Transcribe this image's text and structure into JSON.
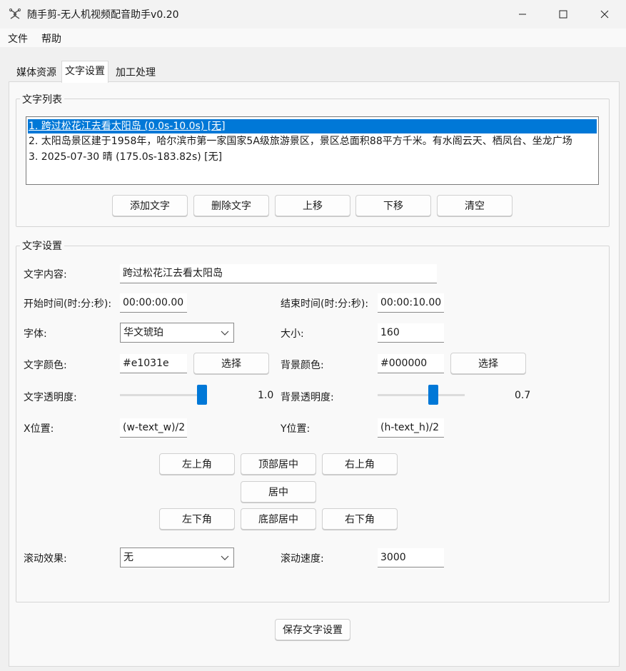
{
  "window": {
    "title": "随手剪-无人机视频配音助手v0.20",
    "minimize_icon": "minimize-icon",
    "maximize_icon": "maximize-icon",
    "close_icon": "close-icon"
  },
  "menu": {
    "items": [
      "文件",
      "帮助"
    ]
  },
  "tabs": [
    {
      "label": "媒体资源",
      "active": false
    },
    {
      "label": "文字设置",
      "active": true
    },
    {
      "label": "加工处理",
      "active": false
    }
  ],
  "text_list": {
    "group_title": "文字列表",
    "items": [
      "1. 跨过松花江去看太阳岛 (0.0s-10.0s) [无]",
      "2. 太阳岛景区建于1958年，哈尔滨市第一家国家5A级旅游景区，景区总面积88平方千米。有水阁云天、栖凤台、坐龙广场",
      "3. 2025-07-30 晴 (175.0s-183.82s) [无]"
    ],
    "selected_index": 0,
    "buttons": {
      "add": "添加文字",
      "delete": "删除文字",
      "move_up": "上移",
      "move_down": "下移",
      "clear": "清空"
    }
  },
  "text_settings": {
    "group_title": "文字设置",
    "content_label": "文字内容:",
    "content_value": "跨过松花江去看太阳岛",
    "start_label": "开始时间(时:分:秒):",
    "start_value": "00:00:00.00",
    "end_label": "结束时间(时:分:秒):",
    "end_value": "00:00:10.00",
    "font_label": "字体:",
    "font_value": "华文琥珀",
    "size_label": "大小:",
    "size_value": "160",
    "text_color_label": "文字颜色:",
    "text_color_value": "#e1031e",
    "text_color_button": "选择",
    "bg_color_label": "背景颜色:",
    "bg_color_value": "#000000",
    "bg_color_button": "选择",
    "text_opacity_label": "文字透明度:",
    "text_opacity_value": "1.0",
    "text_opacity_level": 1.0,
    "bg_opacity_label": "背景透明度:",
    "bg_opacity_value": "0.7",
    "bg_opacity_level": 0.7,
    "x_label": "X位置:",
    "x_value": "(w-text_w)/2",
    "y_label": "Y位置:",
    "y_value": "(h-text_h)/2",
    "position_buttons": {
      "top_left": "左上角",
      "top_center": "顶部居中",
      "top_right": "右上角",
      "center": "居中",
      "bottom_left": "左下角",
      "bottom_center": "底部居中",
      "bottom_right": "右下角"
    },
    "scroll_effect_label": "滚动效果:",
    "scroll_effect_value": "无",
    "scroll_speed_label": "滚动速度:",
    "scroll_speed_value": "3000"
  },
  "save_button": "保存文字设置",
  "colors": {
    "accent": "#0078d7",
    "selection": "#0078d7"
  }
}
